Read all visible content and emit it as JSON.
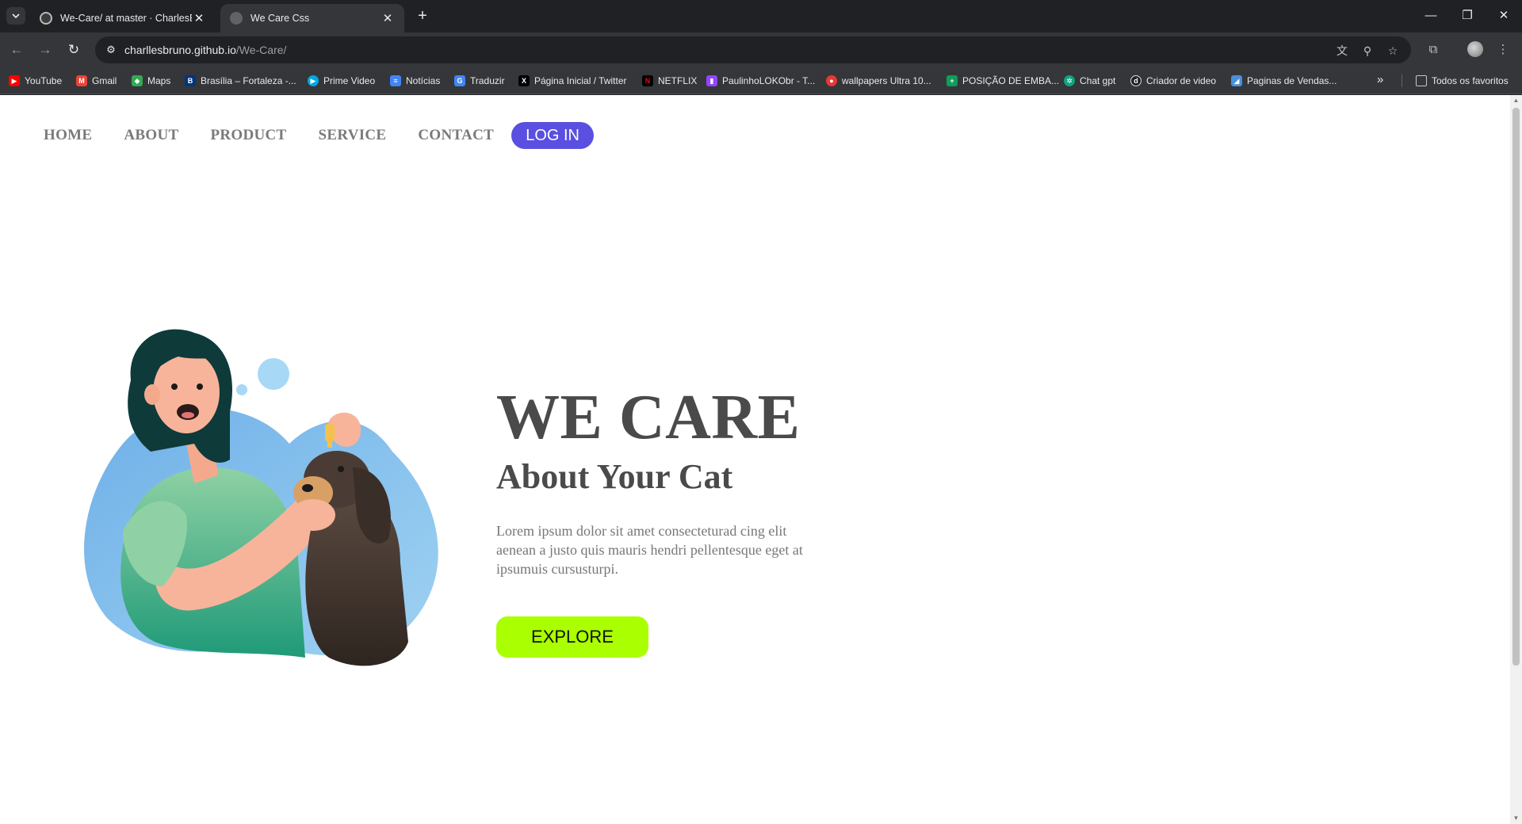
{
  "browser": {
    "tabs": [
      {
        "title": "We-Care/ at master · CharlesBr",
        "active": false
      },
      {
        "title": "We Care Css",
        "active": true
      }
    ],
    "url_host": "charllesbruno.github.io",
    "url_path": "/We-Care/",
    "bookmarks": [
      {
        "label": "YouTube",
        "icon": "youtube-icon",
        "color": "#ff0000"
      },
      {
        "label": "Gmail",
        "icon": "gmail-icon",
        "color": "#ea4335"
      },
      {
        "label": "Maps",
        "icon": "maps-icon",
        "color": "#34a853"
      },
      {
        "label": "Brasília – Fortaleza -...",
        "icon": "booking-icon",
        "color": "#003580"
      },
      {
        "label": "Prime Video",
        "icon": "prime-video-icon",
        "color": "#00a8e1"
      },
      {
        "label": "Notícias",
        "icon": "news-icon",
        "color": "#4285f4"
      },
      {
        "label": "Traduzir",
        "icon": "translate-icon",
        "color": "#4285f4"
      },
      {
        "label": "Página Inicial / Twitter",
        "icon": "x-icon",
        "color": "#000000"
      },
      {
        "label": "NETFLIX",
        "icon": "netflix-icon",
        "color": "#e50914"
      },
      {
        "label": "PaulinhoLOKObr - T...",
        "icon": "twitch-icon",
        "color": "#9146ff"
      },
      {
        "label": "wallpapers Ultra 10...",
        "icon": "wallpaper-icon",
        "color": "#e53935"
      },
      {
        "label": "POSIÇÃO DE EMBA...",
        "icon": "sheets-icon",
        "color": "#0f9d58"
      },
      {
        "label": "Chat gpt",
        "icon": "chatgpt-icon",
        "color": "#10a37f"
      },
      {
        "label": "Criador de video",
        "icon": "video-creator-icon",
        "color": "#222222"
      },
      {
        "label": "Paginas de Vendas...",
        "icon": "sales-page-icon",
        "color": "#4a90d9"
      }
    ],
    "all_bookmarks": "Todos os favoritos"
  },
  "page": {
    "nav": {
      "items": [
        "HOME",
        "ABOUT",
        "PRODUCT",
        "SERVICE",
        "CONTACT"
      ],
      "login": "LOG IN"
    },
    "hero": {
      "title": "WE CARE",
      "subtitle": "About Your Cat",
      "text": "Lorem ipsum dolor sit amet consecteturad cing elit aenean a justo quis mauris hendri pellentesque eget at ipsumuis cursusturpi.",
      "button": "EXPLORE"
    }
  },
  "colors": {
    "accent": "#5a4fe0",
    "explore": "#aaff00",
    "heading": "#4a4a4a"
  }
}
